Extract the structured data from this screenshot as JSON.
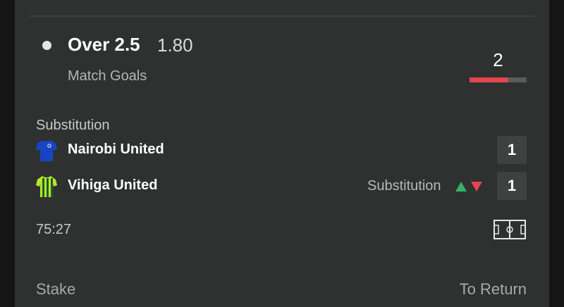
{
  "selection": {
    "name": "Over 2.5",
    "odds": "1.80",
    "market": "Match Goals"
  },
  "goals": {
    "count": "2",
    "progress_fraction": 0.68,
    "color": "#e3454f"
  },
  "event": {
    "label": "Substitution",
    "home": {
      "name": "Nairobi United",
      "score": "1",
      "jersey_icon": "blue-jersey-icon",
      "color": "#1844c4"
    },
    "away": {
      "name": "Vihiga United",
      "score": "1",
      "jersey_icon": "green-striped-jersey-icon",
      "color": "#b6e82a",
      "note": "Substitution"
    }
  },
  "match_time": "75:27",
  "pitch_icon": "football-pitch-icon",
  "footer": {
    "stake_label": "Stake",
    "return_label": "To Return"
  },
  "colors": {
    "up": "#37b068",
    "down": "#e3454f",
    "card": "#2e3130"
  }
}
